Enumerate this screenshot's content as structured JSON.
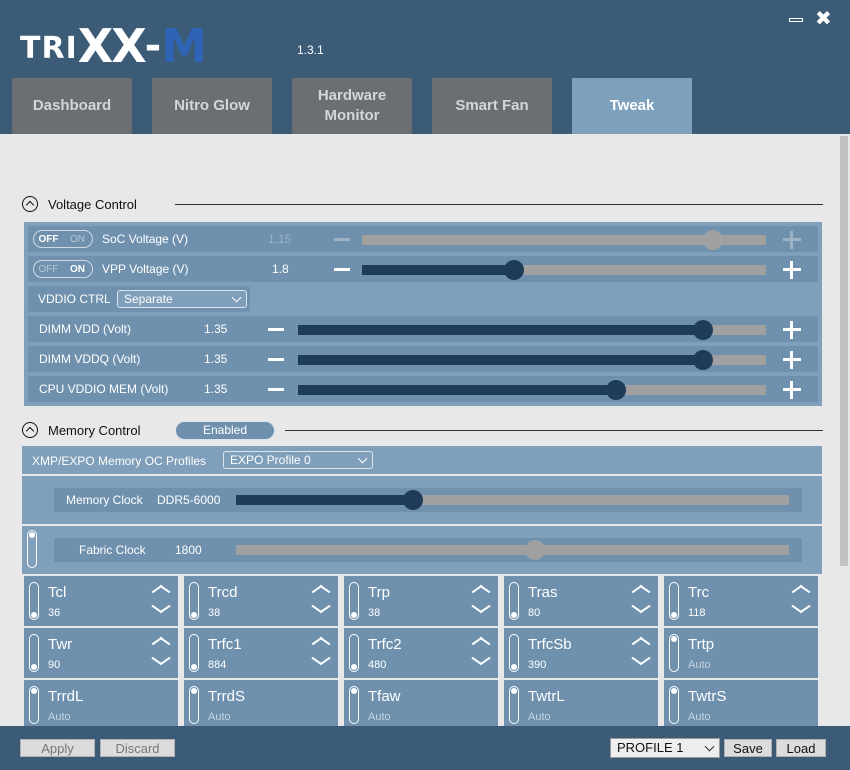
{
  "app": {
    "logo_tri": "TRI",
    "logo_xx": "XX",
    "logo_dash": "-",
    "logo_m": "M",
    "version": "1.3.1",
    "close_glyph": "✖"
  },
  "tabs": [
    {
      "label": "Dashboard"
    },
    {
      "label": "Nitro Glow"
    },
    {
      "label": "Hardware Monitor"
    },
    {
      "label": "Smart Fan"
    },
    {
      "label": "Tweak",
      "active": true
    }
  ],
  "voltage": {
    "title": "Voltage Control",
    "soc": {
      "off": "OFF",
      "on": "ON",
      "state": "off",
      "label": "SoC Voltage (V)",
      "value": "1.15",
      "fraction": 0.87
    },
    "vpp": {
      "off": "OFF",
      "on": "ON",
      "state": "on",
      "label": "VPP Voltage (V)",
      "value": "1.8",
      "fraction": 0.375
    },
    "vddio": {
      "label": "VDDIO CTRL",
      "selected": "Separate"
    },
    "dimm_vdd": {
      "label": "DIMM VDD (Volt)",
      "value": "1.35",
      "fraction": 0.865
    },
    "dimm_vddq": {
      "label": "DIMM VDDQ (Volt)",
      "value": "1.35",
      "fraction": 0.865
    },
    "cpu_vddio": {
      "label": "CPU VDDIO MEM (Volt)",
      "value": "1.35",
      "fraction": 0.68
    }
  },
  "memory": {
    "title": "Memory Control",
    "status": "Enabled",
    "profiles_label": "XMP/EXPO Memory OC Profiles",
    "profile_selected": "EXPO Profile 0",
    "clock": {
      "label": "Memory Clock",
      "value": "DDR5-6000",
      "fraction": 0.32
    },
    "fabric": {
      "label": "Fabric Clock",
      "value": "1800",
      "fraction": 0.54
    }
  },
  "timings": [
    {
      "name": "Tcl",
      "value": "36",
      "arrows": true
    },
    {
      "name": "Trcd",
      "value": "38",
      "arrows": true
    },
    {
      "name": "Trp",
      "value": "38",
      "arrows": true
    },
    {
      "name": "Tras",
      "value": "80",
      "arrows": true
    },
    {
      "name": "Trc",
      "value": "118",
      "arrows": true
    },
    {
      "name": "Twr",
      "value": "90",
      "arrows": true
    },
    {
      "name": "Trfc1",
      "value": "884",
      "arrows": true
    },
    {
      "name": "Trfc2",
      "value": "480",
      "arrows": true
    },
    {
      "name": "TrfcSb",
      "value": "390",
      "arrows": true
    },
    {
      "name": "Trtp",
      "value": "Auto",
      "arrows": false
    },
    {
      "name": "TrrdL",
      "value": "Auto",
      "arrows": false
    },
    {
      "name": "TrrdS",
      "value": "Auto",
      "arrows": false
    },
    {
      "name": "Tfaw",
      "value": "Auto",
      "arrows": false
    },
    {
      "name": "TwtrL",
      "value": "Auto",
      "arrows": false
    },
    {
      "name": "TwtrS",
      "value": "Auto",
      "arrows": false
    }
  ],
  "footer": {
    "apply": "Apply",
    "discard": "Discard",
    "profile": "PROFILE 1",
    "save": "Save",
    "load": "Load"
  }
}
